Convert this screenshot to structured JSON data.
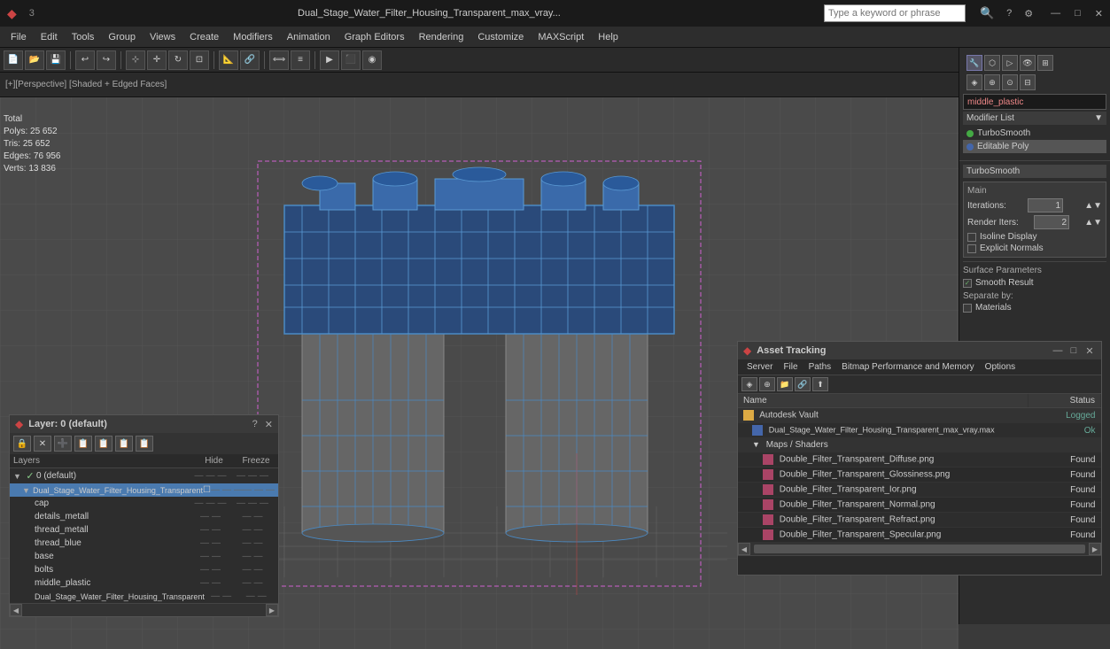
{
  "titlebar": {
    "title": "Dual_Stage_Water_Filter_Housing_Transparent_max_vray...",
    "search_placeholder": "Type a keyword or phrase",
    "min_btn": "—",
    "max_btn": "□",
    "close_btn": "✕"
  },
  "menubar": {
    "items": [
      "File",
      "Edit",
      "Tools",
      "Group",
      "Views",
      "Create",
      "Modifiers",
      "Animation",
      "Graph Editors",
      "Rendering",
      "Customize",
      "MAXScript",
      "Help"
    ]
  },
  "viewport": {
    "label": "[+][Perspective] [Shaded + Edged Faces]",
    "stats_label": "Total",
    "polys": "Polys: 25 652",
    "tris": "Tris: 25 652",
    "edges": "Edges: 76 956",
    "verts": "Verts: 13 836"
  },
  "right_panel": {
    "material_name": "middle_plastic",
    "modifier_list_label": "Modifier List",
    "modifiers": [
      {
        "name": "TurboSmooth",
        "color": "green"
      },
      {
        "name": "Editable Poly",
        "color": "blue"
      }
    ],
    "turbos": {
      "title": "TurboSmooth",
      "main_label": "Main",
      "iterations_label": "Iterations:",
      "iterations_val": "1",
      "render_iters_label": "Render Iters:",
      "render_iters_val": "2",
      "isoline_label": "Isoline Display",
      "explicit_label": "Explicit Normals",
      "surface_label": "Surface Parameters",
      "smooth_label": "Smooth Result",
      "separate_label": "Separate by:",
      "materials_label": "Materials"
    }
  },
  "layer_dialog": {
    "title": "Layer: 0 (default)",
    "help_btn": "?",
    "close_btn": "✕",
    "toolbar_icons": [
      "🔒",
      "✕",
      "➕",
      "📋",
      "📋",
      "📋",
      "📋"
    ],
    "headers": {
      "layers": "Layers",
      "hide": "Hide",
      "freeze": "Freeze"
    },
    "layers": [
      {
        "name": "0 (default)",
        "indent": 0,
        "checked": true,
        "is_default": true
      },
      {
        "name": "Dual_Stage_Water_Filter_Housing_Transparent",
        "indent": 1,
        "checked": false,
        "selected": true
      },
      {
        "name": "cap",
        "indent": 2
      },
      {
        "name": "details_metall",
        "indent": 2
      },
      {
        "name": "thread_metall",
        "indent": 2
      },
      {
        "name": "thread_blue",
        "indent": 2
      },
      {
        "name": "base",
        "indent": 2
      },
      {
        "name": "bolts",
        "indent": 2
      },
      {
        "name": "middle_plastic",
        "indent": 2
      },
      {
        "name": "Dual_Stage_Water_Filter_Housing_Transparent",
        "indent": 2
      }
    ]
  },
  "asset_dialog": {
    "title": "Asset Tracking",
    "min_btn": "—",
    "max_btn": "□",
    "close_btn": "✕",
    "menu_items": [
      "Server",
      "File",
      "Paths",
      "Bitmap Performance and Memory",
      "Options"
    ],
    "col_name": "Name",
    "col_status": "Status",
    "rows": [
      {
        "type": "vault",
        "name": "Autodesk Vault",
        "indent": 1,
        "status": "Logged"
      },
      {
        "type": "file",
        "name": "Dual_Stage_Water_Filter_Housing_Transparent_max_vray.max",
        "indent": 2,
        "status": "Ok"
      },
      {
        "type": "maps",
        "name": "Maps / Shaders",
        "indent": 2,
        "status": ""
      },
      {
        "type": "item",
        "name": "Double_Filter_Transparent_Diffuse.png",
        "indent": 3,
        "status": "Found"
      },
      {
        "type": "item",
        "name": "Double_Filter_Transparent_Glossiness.png",
        "indent": 3,
        "status": "Found"
      },
      {
        "type": "item",
        "name": "Double_Filter_Transparent_Ior.png",
        "indent": 3,
        "status": "Found"
      },
      {
        "type": "item",
        "name": "Double_Filter_Transparent_Normal.png",
        "indent": 3,
        "status": "Found"
      },
      {
        "type": "item",
        "name": "Double_Filter_Transparent_Refract.png",
        "indent": 3,
        "status": "Found"
      },
      {
        "type": "item",
        "name": "Double_Filter_Transparent_Specular.png",
        "indent": 3,
        "status": "Found"
      }
    ]
  }
}
